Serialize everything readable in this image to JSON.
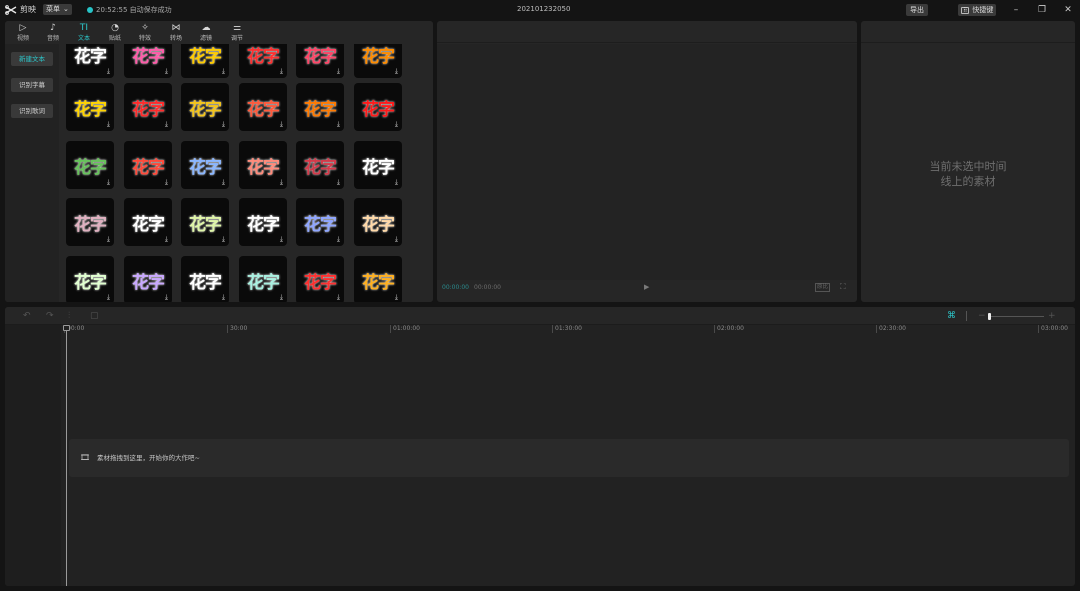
{
  "topbar": {
    "app_name": "剪映",
    "menu_label": "菜单",
    "save_status": "20:52:55 自动保存成功",
    "project_title": "202101232050",
    "export_label": "导出",
    "shortcut_label": "快捷键"
  },
  "tabs": [
    {
      "icon": "▷",
      "label": "视频",
      "name": "video"
    },
    {
      "icon": "♪",
      "label": "音频",
      "name": "audio"
    },
    {
      "icon": "TI",
      "label": "文本",
      "name": "text"
    },
    {
      "icon": "◔",
      "label": "贴纸",
      "name": "sticker"
    },
    {
      "icon": "✧",
      "label": "特效",
      "name": "effect"
    },
    {
      "icon": "⋈",
      "label": "转场",
      "name": "transition"
    },
    {
      "icon": "☁",
      "label": "滤镜",
      "name": "filter"
    },
    {
      "icon": "⚌",
      "label": "调节",
      "name": "adjust"
    }
  ],
  "active_tab": 2,
  "subnav": [
    "新建文本",
    "识别字幕",
    "识别歌词"
  ],
  "grid": {
    "word": "花字",
    "styles": [
      [
        "#ffffff",
        "#ff5aa8",
        "#ffcc00",
        "#ff3030",
        "#ff4466",
        "#ff8c00"
      ],
      [
        "#ffd400",
        "#ff2b2b",
        "#f4c51a",
        "#ff5a3c",
        "#ff7a00",
        "#ff1a1a"
      ],
      [
        "#66c25a",
        "#ff4a3a",
        "#8ab6ff",
        "#ff8a7a",
        "#d43a4a",
        "#ffffff"
      ],
      [
        "#e0b0c0",
        "#ffffff",
        "#dff5a8",
        "#ffffff",
        "#8fa6ff",
        "#ffd9a8"
      ],
      [
        "#e0ffd0",
        "#c9a8ff",
        "#ffffff",
        "#a8f0e0",
        "#ff3030",
        "#ffb020"
      ]
    ]
  },
  "player": {
    "current_time": "00:00:00",
    "total_time": "00:00:00",
    "ratio_label": "原比"
  },
  "inspector": {
    "empty_line1": "当前未选中时间",
    "empty_line2": "线上的素材"
  },
  "timeline": {
    "ruler": [
      "00:00",
      "30:00",
      "01:00:00",
      "01:30:00",
      "02:00:00",
      "02:30:00",
      "03:00:00"
    ],
    "drop_hint": "素材拖拽到这里，开始你的大作吧~"
  },
  "colors": {
    "accent": "#2cc7cb",
    "panel": "#262626",
    "background": "#141414"
  }
}
